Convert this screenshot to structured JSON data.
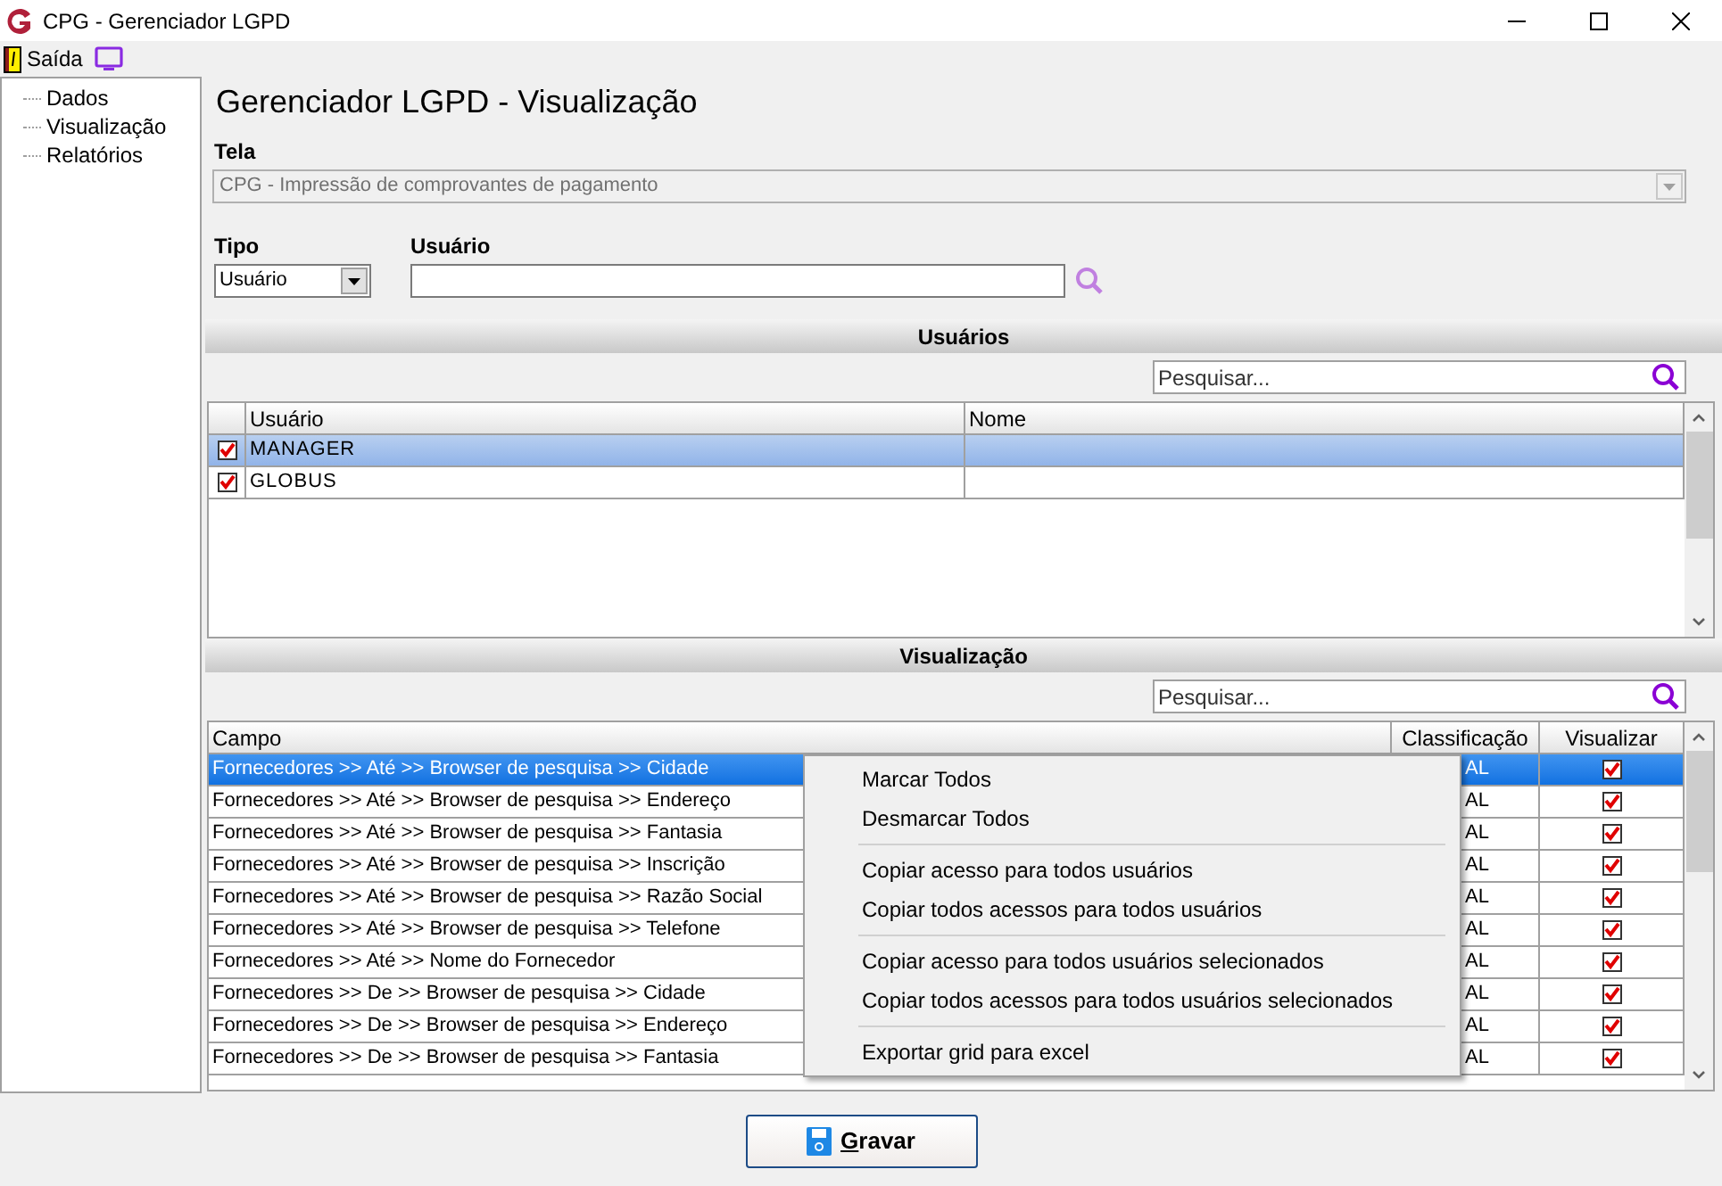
{
  "window": {
    "title": "CPG - Gerenciador LGPD"
  },
  "toolbar": {
    "exit_label": "Saída"
  },
  "sidebar": {
    "items": [
      {
        "label": "Dados",
        "selected": false
      },
      {
        "label": "Visualização",
        "selected": false
      },
      {
        "label": "Relatórios",
        "selected": false
      }
    ]
  },
  "heading": "Gerenciador LGPD - Visualização",
  "tela": {
    "label": "Tela",
    "value": "CPG - Impressão de comprovantes de pagamento"
  },
  "tipo": {
    "label": "Tipo",
    "value": "Usuário"
  },
  "usuario": {
    "label": "Usuário"
  },
  "users_section": {
    "title": "Usuários",
    "search_placeholder": "Pesquisar...",
    "columns": [
      "Usuário",
      "Nome"
    ],
    "rows": [
      {
        "checked": true,
        "selected": true,
        "usuario": "MANAGER"
      },
      {
        "checked": true,
        "selected": false,
        "usuario": "GLOBUS"
      }
    ]
  },
  "view_section": {
    "title": "Visualização",
    "search_placeholder": "Pesquisar...",
    "columns": [
      "Campo",
      "Classificação",
      "Visualizar"
    ],
    "rows": [
      {
        "campo": "Fornecedores >> Até >> Browser de pesquisa >> Cidade",
        "classificacao": "AL",
        "visualizar": true,
        "selected": true
      },
      {
        "campo": "Fornecedores >> Até >> Browser de pesquisa >> Endereço",
        "classificacao": "AL",
        "visualizar": true,
        "selected": false
      },
      {
        "campo": "Fornecedores >> Até >> Browser de pesquisa >> Fantasia",
        "classificacao": "AL",
        "visualizar": true,
        "selected": false
      },
      {
        "campo": "Fornecedores >> Até >> Browser de pesquisa >> Inscrição",
        "classificacao": "AL",
        "visualizar": true,
        "selected": false
      },
      {
        "campo": "Fornecedores >> Até >> Browser de pesquisa >> Razão Social",
        "classificacao": "AL",
        "visualizar": true,
        "selected": false
      },
      {
        "campo": "Fornecedores >> Até >> Browser de pesquisa >> Telefone",
        "classificacao": "AL",
        "visualizar": true,
        "selected": false
      },
      {
        "campo": "Fornecedores >> Até >> Nome do Fornecedor",
        "classificacao": "AL",
        "visualizar": true,
        "selected": false
      },
      {
        "campo": "Fornecedores >> De >> Browser de pesquisa >> Cidade",
        "classificacao": "AL",
        "visualizar": true,
        "selected": false
      },
      {
        "campo": "Fornecedores >> De >> Browser de pesquisa >> Endereço",
        "classificacao": "AL",
        "visualizar": true,
        "selected": false
      },
      {
        "campo": "Fornecedores >> De >> Browser de pesquisa >> Fantasia",
        "classificacao": "AL",
        "visualizar": true,
        "selected": false
      }
    ]
  },
  "context_menu": {
    "groups": [
      [
        "Marcar Todos",
        "Desmarcar Todos"
      ],
      [
        "Copiar acesso para todos usuários",
        "Copiar todos acessos para todos usuários"
      ],
      [
        "Copiar acesso para todos usuários selecionados",
        "Copiar todos acessos para todos usuários selecionados"
      ],
      [
        "Exportar grid para excel"
      ]
    ]
  },
  "save_button": "Gravar"
}
